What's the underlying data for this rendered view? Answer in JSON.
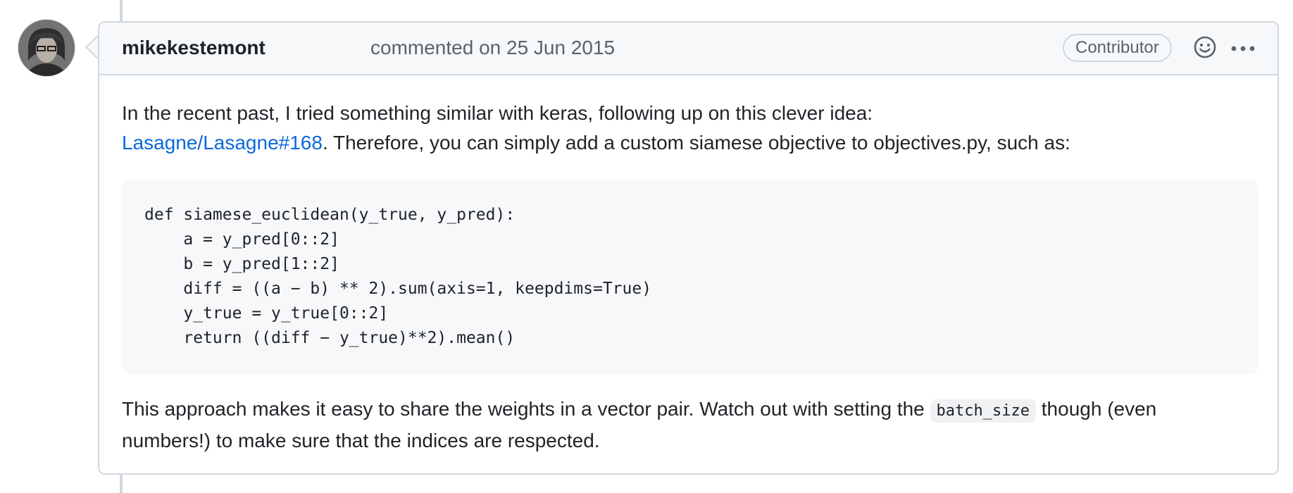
{
  "comment": {
    "author": "mikekestemont",
    "meta": "commented on 25 Jun 2015",
    "badge": "Contributor",
    "icons": {
      "reaction": "smiley-icon",
      "more": "kebab-horizontal-icon"
    },
    "body": {
      "para1_text_a": "In the recent past, I tried something similar with keras, following up on this clever idea:",
      "para1_link": "Lasagne/Lasagne#168",
      "para1_text_b": ". Therefore, you can simply add a custom siamese objective to objectives.py, such as:",
      "code_lines": [
        "def siamese_euclidean(y_true, y_pred):",
        "    a = y_pred[0::2]",
        "    b = y_pred[1::2]",
        "    diff = ((a − b) ** 2).sum(axis=1, keepdims=True)",
        "    y_true = y_true[0::2]",
        "    return ((diff − y_true)**2).mean()"
      ],
      "para2_text_a": "This approach makes it easy to share the weights in a vector pair. Watch out with setting the ",
      "para2_code": "batch_size",
      "para2_text_b": " though (even numbers!) to make sure that the indices are respected."
    }
  },
  "colors": {
    "link": "#0969da",
    "border": "#d0d7de",
    "header_bg": "#f6f8fa",
    "muted_text": "#59636e"
  }
}
